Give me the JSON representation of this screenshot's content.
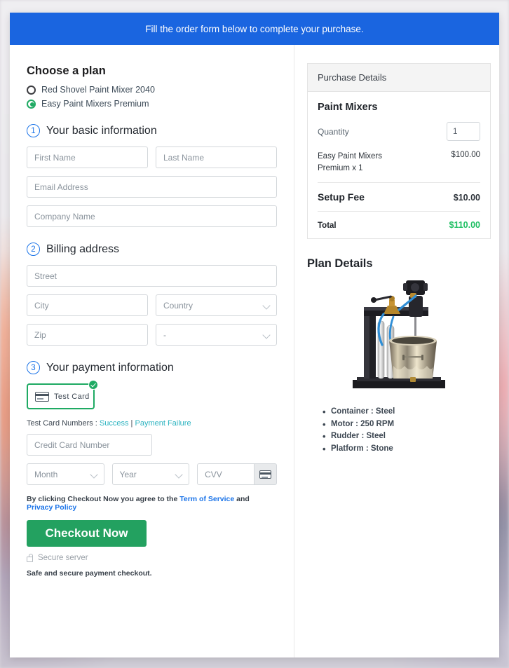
{
  "banner": {
    "text": "Fill the order form below to complete your purchase."
  },
  "plan": {
    "heading": "Choose a plan",
    "options": [
      {
        "label": "Red Shovel Paint Mixer 2040",
        "selected": false
      },
      {
        "label": "Easy Paint Mixers Premium",
        "selected": true
      }
    ]
  },
  "steps": {
    "basic": {
      "num": "1",
      "title": "Your basic information"
    },
    "billing": {
      "num": "2",
      "title": "Billing address"
    },
    "payment": {
      "num": "3",
      "title": "Your payment information"
    }
  },
  "fields": {
    "first_name": "First Name",
    "last_name": "Last Name",
    "email": "Email Address",
    "company": "Company Name",
    "street": "Street",
    "city": "City",
    "country": "Country",
    "zip": "Zip",
    "state": "-",
    "credit_card": "Credit Card Number",
    "month": "Month",
    "year": "Year",
    "cvv": "CVV"
  },
  "payment": {
    "card_option_label": "Test Card",
    "test_prefix": "Test Card Numbers : ",
    "test_success": "Success",
    "test_separator": " | ",
    "test_failure": "Payment Failure",
    "agree_prefix": "By clicking Checkout Now you agree to the ",
    "agree_tos": "Term of Service",
    "agree_and": " and ",
    "agree_privacy": "Privacy Policy",
    "checkout_label": "Checkout Now",
    "secure_server": "Secure server",
    "safe_note": "Safe and secure payment checkout."
  },
  "purchase": {
    "panel_title": "Purchase Details",
    "product_title": "Paint Mixers",
    "quantity_label": "Quantity",
    "quantity_value": "1",
    "line_item_name": "Easy Paint Mixers Premium x 1",
    "line_item_price": "$100.00",
    "setup_fee_label": "Setup Fee",
    "setup_fee_price": "$10.00",
    "total_label": "Total",
    "total_price": "$110.00"
  },
  "plan_details": {
    "title": "Plan Details",
    "image_alt": "paint-mixer-machine-photo",
    "specs": [
      "Container : Steel",
      "Motor : 250 RPM",
      "Rudder : Steel",
      "Platform : Stone"
    ]
  },
  "colors": {
    "banner_blue": "#1a65e0",
    "accent_green": "#1faa63",
    "checkout_green": "#23a160",
    "total_green": "#1fbf63",
    "link_blue": "#1a73e8",
    "link_teal": "#2bb3c0"
  }
}
